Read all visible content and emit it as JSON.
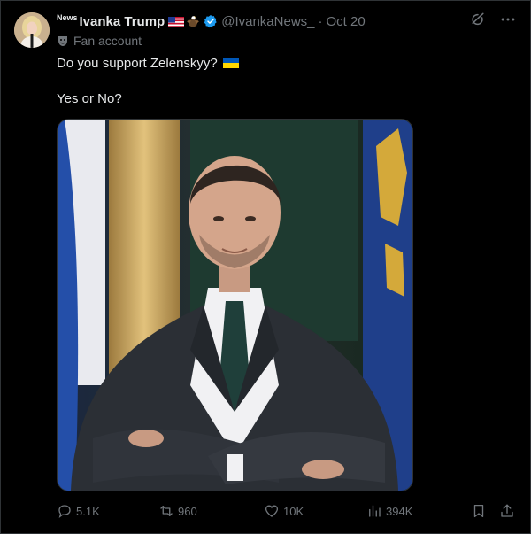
{
  "author": {
    "news_tag": "News",
    "name": "Ivanka Trump",
    "handle": "@IvankaNews_",
    "separator": "·",
    "date": "Oct 20",
    "sub_label": "Fan account"
  },
  "tweet": {
    "line1": "Do you support Zelenskyy?",
    "line2": "Yes or No?"
  },
  "stats": {
    "replies": "5.1K",
    "reposts": "960",
    "likes": "10K",
    "views": "394K"
  },
  "colors": {
    "background": "#000000",
    "text": "#e7e9ea",
    "muted": "#71767b",
    "verified": "#1d9bf0",
    "border": "#2f3336"
  },
  "icons": {
    "top_right": [
      "grok-icon",
      "more-icon"
    ],
    "actions": [
      "reply-icon",
      "repost-icon",
      "like-icon",
      "views-icon",
      "bookmark-icon",
      "share-icon"
    ]
  }
}
